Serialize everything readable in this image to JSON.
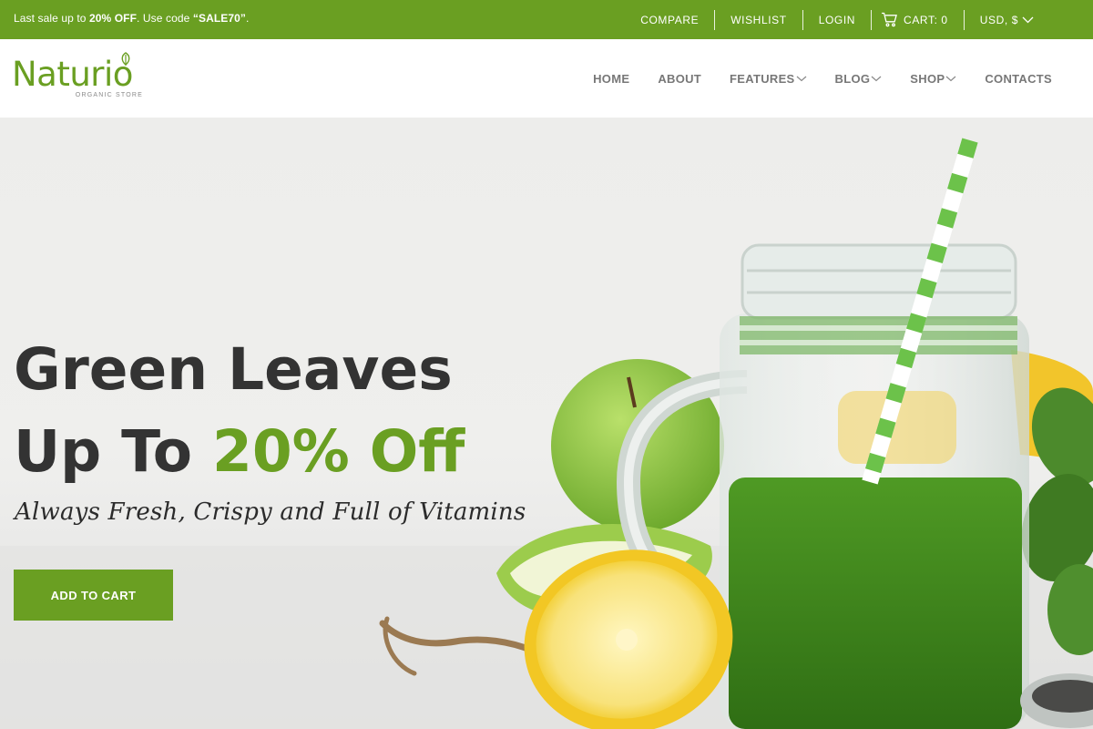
{
  "topbar": {
    "promo_prefix": "Last sale up to ",
    "promo_discount": "20% OFF",
    "promo_middle": ". Use code ",
    "promo_code": "“SALE70”",
    "promo_suffix": ".",
    "compare": "COMPARE",
    "wishlist": "WISHLIST",
    "login": "LOGIN",
    "cart": "CART: 0",
    "currency": "USD, $",
    "icons": {
      "cart": "cart-icon",
      "currency": "chevron-down-icon"
    }
  },
  "header": {
    "logo_name": "Naturio",
    "logo_tagline": "ORGANIC STORE",
    "nav": {
      "home": "HOME",
      "about": "ABOUT",
      "features": "FEATURES",
      "blog": "BLOG",
      "shop": "SHOP",
      "contacts": "CONTACTS"
    }
  },
  "hero": {
    "headline_line1": "Green Leaves",
    "headline_line2_prefix": "Up To ",
    "headline_line2_accent": "20% Off",
    "subline": "Always Fresh, Crispy and Full of Vitamins",
    "cta": "ADD TO CART"
  },
  "colors": {
    "brand_green": "#6a9f22",
    "text_dark": "#333333",
    "nav_gray": "#777777"
  }
}
